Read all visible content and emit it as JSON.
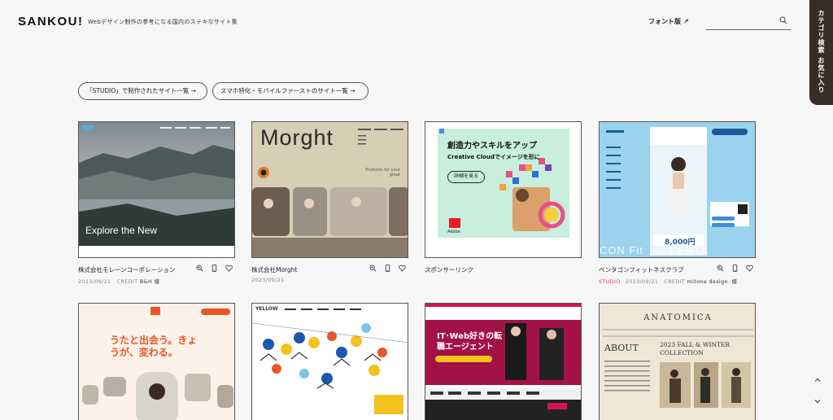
{
  "header": {
    "logo": "SANKOU!",
    "tagline": "Webデザイン制作の参考になる国内のステキなサイト集",
    "font_link": "フォント版",
    "search_placeholder": ""
  },
  "side_tab": {
    "category": "カテゴリ検索",
    "favorites": "お気に入り"
  },
  "pills": [
    "「STUDIO」で制作されたサイト一覧 →",
    "スマホ特化・モバイルファーストのサイト一覧 →"
  ],
  "cards_row1": [
    {
      "title": "株式会社モレーンコーポレーション",
      "date": "2023/09/21",
      "credit_label": "CREDIT",
      "credit_name": "B&H 様",
      "studio": "",
      "thumb_text": "Explore the New",
      "has_icons": true
    },
    {
      "title": "株式会社Morght",
      "date": "2023/09/21",
      "credit_label": "",
      "credit_name": "",
      "studio": "",
      "thumb_text": "Morght",
      "thumb_sub": "Products for your great",
      "has_icons": true
    },
    {
      "title": "スポンサーリンク",
      "date": "",
      "credit_label": "",
      "credit_name": "",
      "studio": "",
      "ad_head": "創造力やスキルをアップ",
      "ad_sub": "Creative Cloudでイメージを形に",
      "ad_btn": "詳細を見る",
      "ad_brand": "Adobe",
      "has_icons": false
    },
    {
      "title": "ペンタゴンフィットネスクラブ",
      "date": "2023/09/21",
      "credit_label": "CREDIT",
      "credit_name": "mitone design. 様",
      "studio": "STUDIO",
      "thumb_text": "CON Fit       PENTA",
      "price": "8,000円",
      "has_icons": true
    }
  ],
  "cards_row2": [
    {
      "thumb_text": "うたと出会う。きょうが、変わる。"
    },
    {
      "thumb_text": "YELLOW"
    },
    {
      "thumb_text": "IT･Web好きの転職エージェント"
    },
    {
      "thumb_text": "ANATOMICA",
      "thumb_sub": "2023 FALL & WINTER COLLECTION",
      "thumb_about": "ABOUT"
    }
  ],
  "colors": {
    "side_tab": "#3a2d27",
    "studio": "#d9368a",
    "background": "#f7f7f7"
  }
}
